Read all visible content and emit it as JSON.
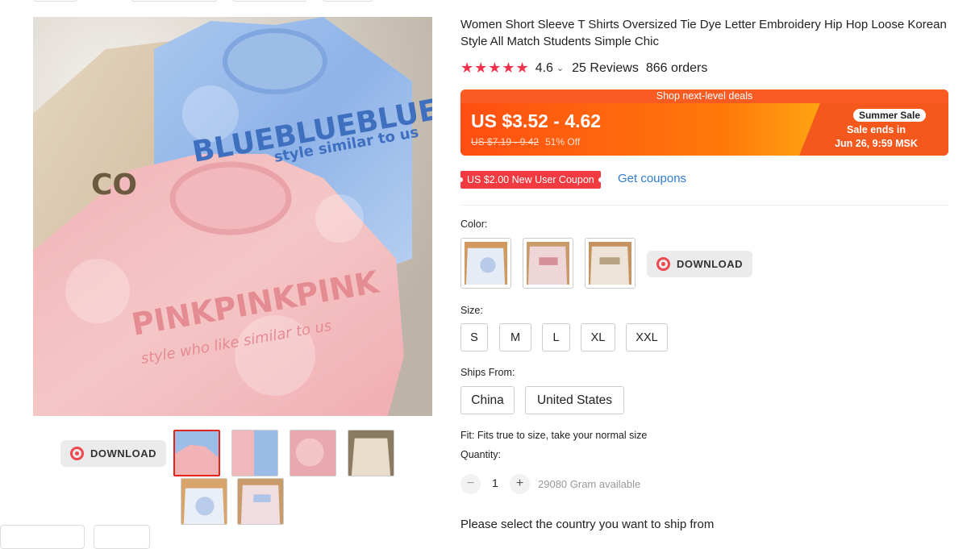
{
  "product": {
    "title": "Women Short Sleeve T Shirts Oversized Tie Dye Letter Embroidery Hip Hop Loose Korean Style All Match Students Simple Chic",
    "rating_value": "4.6",
    "reviews": "25 Reviews",
    "orders": "866 orders",
    "stars": "★★★★★",
    "chevron": "⌄"
  },
  "images": {
    "main_texts": [
      "BLUEBLUEBLUE",
      "style similar to us",
      "PINKPINKPINK",
      "style who like similar to us",
      "CO"
    ],
    "download_label": "DOWNLOAD",
    "thumbnails": [
      "blue-pink",
      "blue-pink-2",
      "pink",
      "beige",
      "white-blue",
      "pink-white"
    ]
  },
  "promo": {
    "header": "Shop next-level deals",
    "price": "US $3.52 - 4.62",
    "old_price": "US $7.19 - 9.42",
    "discount": "51% Off",
    "badge": "Summer Sale",
    "ends_line1": "Sale ends in",
    "ends_line2": "Jun 26, 9:59 MSK"
  },
  "coupon": {
    "label": "US $2.00 New User Coupon",
    "link": "Get coupons"
  },
  "color": {
    "label": "Color:",
    "download_label": "DOWNLOAD"
  },
  "size": {
    "label": "Size:",
    "options": [
      "S",
      "M",
      "L",
      "XL",
      "XXL"
    ]
  },
  "ships": {
    "label": "Ships From:",
    "options": [
      "China",
      "United States"
    ]
  },
  "fit": "Fit: Fits true to size, take your normal size",
  "quantity": {
    "label": "Quantity:",
    "minus": "−",
    "value": "1",
    "plus": "+",
    "available": "29080 Gram available"
  },
  "shipping_note": "Please select the country you want to ship from",
  "colors": {
    "accent": "#f4324b",
    "promo_orange": "#ff6a00",
    "link_blue": "#2f7bd1",
    "coupon_red": "#f23a40"
  }
}
